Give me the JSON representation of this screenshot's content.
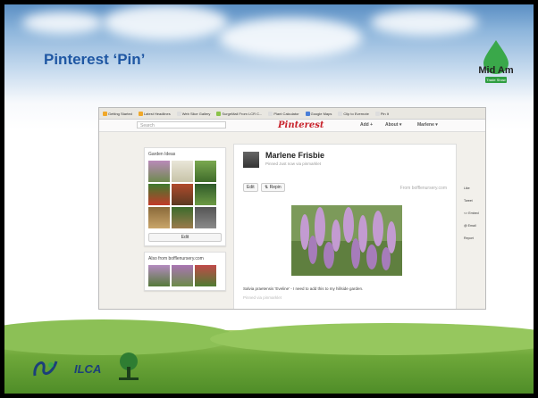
{
  "slide": {
    "title": "Pinterest ‘Pin’",
    "logo_text": "Mid Am",
    "logo_sub": "Trade Show",
    "footer_logo_2": "ILCA"
  },
  "browser": {
    "bookmarks": [
      "Getting Started",
      "Latest Headlines",
      "Web Slice Gallery",
      "SurgeMail From LCR C...",
      "Plant Calculator",
      "Google Maps",
      "Clip to Evernote",
      "Pin It"
    ]
  },
  "pinterest": {
    "search_placeholder": "Search",
    "brand": "Pinterest",
    "nav": {
      "add": "Add +",
      "about": "About ▾",
      "user": "Marlene ▾"
    },
    "board": {
      "title": "Garden Ideas",
      "edit_label": "Edit"
    },
    "also_from": "Also from bofflenursery.com",
    "pin": {
      "user": "Marlene Frisbie",
      "pinned": "Pinned Just now via pinmarklet",
      "edit_label": "Edit",
      "repin_label": "Repin",
      "from": "From bofflenursery.com",
      "caption": "Salvia praetensis 'Eveline' - I need to add this to my hillside garden.",
      "pinned_via": "Pinned via pinmarklet"
    },
    "sidebar": [
      "Like",
      "Tweet",
      "<> Embed",
      "@ Email",
      "Report"
    ]
  },
  "colors": {
    "title": "#1f57a3",
    "pinterest_red": "#c8232c",
    "grass": "#6fa83a"
  }
}
